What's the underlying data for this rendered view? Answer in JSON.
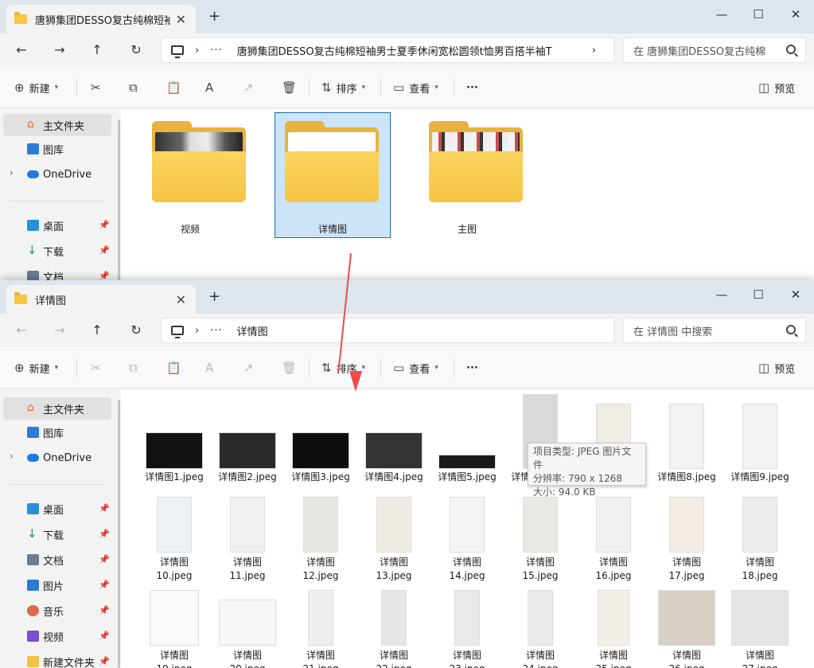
{
  "window1": {
    "tab_title": "唐狮集团DESSO复古纯棉短袖男士夏季休闲宽松圆领t恤男百搭半袖T",
    "address_path": "唐狮集团DESSO复古纯棉短袖男士夏季休闲宽松圆领t恤男百搭半袖T",
    "search_placeholder": "在 唐狮集团DESSO复古纯棉",
    "folders": [
      {
        "label": "视频"
      },
      {
        "label": "详情图"
      },
      {
        "label": "主图"
      }
    ],
    "sidebar": [
      "主文件夹",
      "图库",
      "OneDrive",
      "桌面",
      "下载",
      "文档"
    ]
  },
  "window2": {
    "tab_title": "详情图",
    "address_path": "详情图",
    "search_placeholder": "在 详情图 中搜索",
    "sidebar": [
      "主文件夹",
      "图库",
      "OneDrive",
      "桌面",
      "下载",
      "文档",
      "图片",
      "音乐",
      "视频",
      "新建文件夹"
    ],
    "files": [
      "详情图1.jpeg",
      "详情图2.jpeg",
      "详情图3.jpeg",
      "详情图4.jpeg",
      "详情图5.jpeg",
      "详情图6.jpeg",
      "详情图7.jpeg",
      "详情图8.jpeg",
      "详情图9.jpeg",
      "详情图 10.jpeg",
      "详情图 11.jpeg",
      "详情图 12.jpeg",
      "详情图 13.jpeg",
      "详情图 14.jpeg",
      "详情图 15.jpeg",
      "详情图 16.jpeg",
      "详情图 17.jpeg",
      "详情图 18.jpeg",
      "详情图 19.jpeg",
      "详情图 20.jpeg",
      "详情图 21.jpeg",
      "详情图 22.jpeg",
      "详情图 23.jpeg",
      "详情图 24.jpeg",
      "详情图 25.jpeg",
      "详情图 26.jpeg",
      "详情图 27.jpeg"
    ],
    "tooltip": {
      "type": "项目类型: JPEG 图片文件",
      "resolution": "分辨率: 790 x 1268",
      "size": "大小: 94.0 KB"
    }
  },
  "toolbar": {
    "new_label": "新建",
    "sort_label": "排序",
    "view_label": "查看",
    "more_label": "···",
    "preview_label": "预览"
  },
  "nav": {
    "back": "←",
    "forward": "→",
    "up": "↑",
    "refresh": "↻",
    "sep": "›",
    "dots": "···"
  },
  "window_controls": {
    "minimize": "—",
    "maximize": "☐",
    "close": "✕"
  },
  "tab_close": "✕",
  "tab_add": "+",
  "icons": {
    "cut": "✂",
    "copy": "⧉",
    "paste": "📋",
    "rename": "A",
    "share": "↗",
    "delete": "🗑",
    "sort": "⇅",
    "view": "▭",
    "preview": "◫",
    "new": "⊕",
    "pin": "📌",
    "expand": "›"
  },
  "colors": {
    "accent": "#1b6fb5",
    "selection": "#cce4f7",
    "folder": "#f6c443",
    "arrow": "#ee4b4b"
  }
}
